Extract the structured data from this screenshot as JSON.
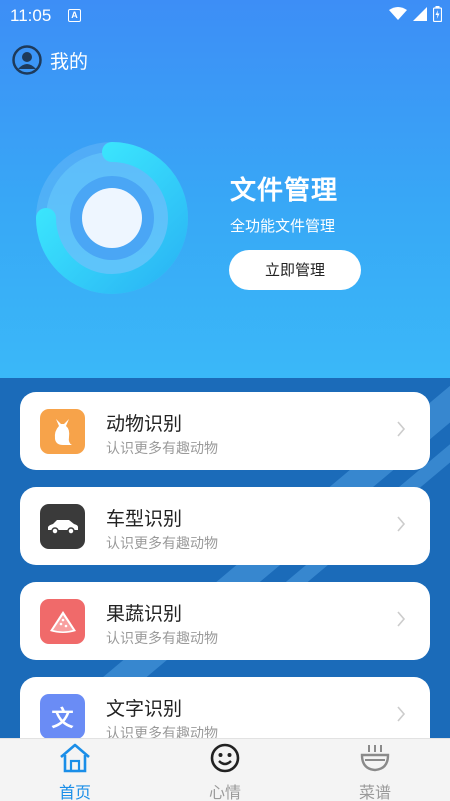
{
  "status_bar": {
    "time": "11:05",
    "notification_icon": "A"
  },
  "header": {
    "mine_label": "我的"
  },
  "hero": {
    "title": "文件管理",
    "subtitle": "全功能文件管理",
    "button_label": "立即管理"
  },
  "cards": [
    {
      "title": "动物识别",
      "subtitle": "认识更多有趣动物",
      "icon": "cat-icon",
      "color": "#f7a34a"
    },
    {
      "title": "车型识别",
      "subtitle": "认识更多有趣动物",
      "icon": "car-icon",
      "color": "#3a3a3a"
    },
    {
      "title": "果蔬识别",
      "subtitle": "认识更多有趣动物",
      "icon": "watermelon-icon",
      "color": "#f06a6a"
    },
    {
      "title": "文字识别",
      "subtitle": "认识更多有趣动物",
      "icon": "text-icon",
      "icon_text": "文",
      "color": "#6a8cf5"
    }
  ],
  "tabs": [
    {
      "label": "首页",
      "icon": "home-icon",
      "active": true,
      "color": "#1a8ee8"
    },
    {
      "label": "心情",
      "icon": "smile-icon",
      "active": false,
      "color": "#9a9a9a"
    },
    {
      "label": "菜谱",
      "icon": "bowl-icon",
      "active": false,
      "color": "#9a9a9a"
    }
  ]
}
